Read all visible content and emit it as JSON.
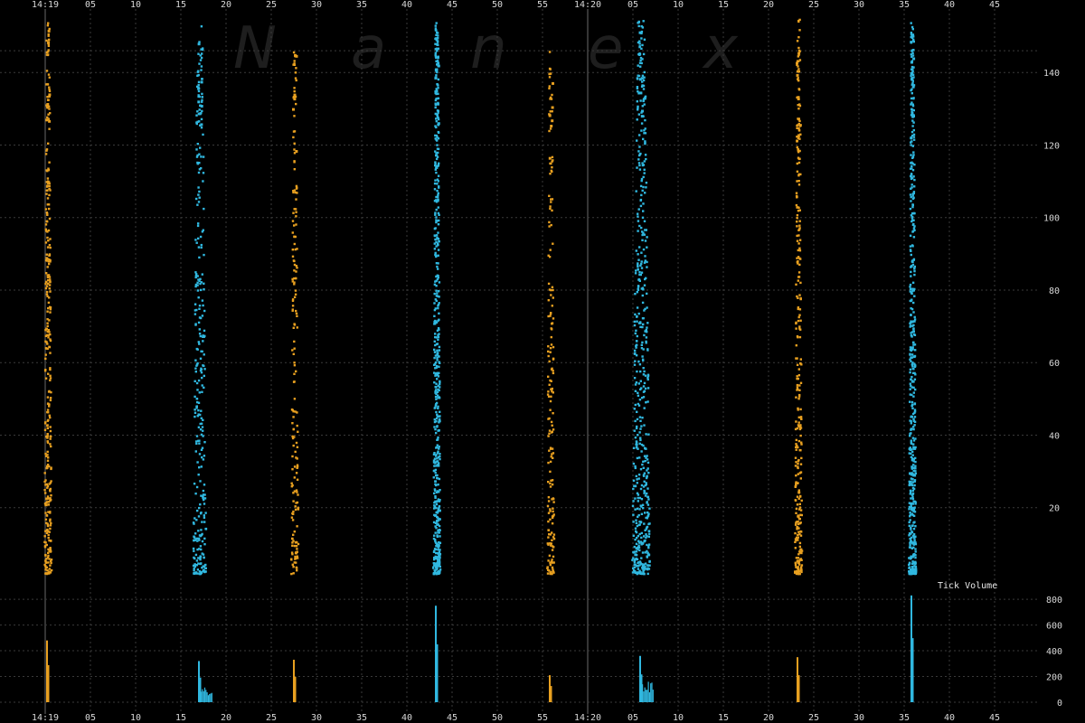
{
  "watermark": [
    "N",
    "a",
    "n",
    "e",
    "x"
  ],
  "colors": {
    "background": "#000000",
    "orange": "#e8a020",
    "blue": "#30b8e0",
    "grid": "#3a3a3a",
    "text": "#d8d8d8"
  },
  "chart_data": [
    {
      "type": "scatter",
      "title": "",
      "xlabel": "",
      "ylabel": "",
      "x_unit": "seconds after 14:19",
      "xlim": [
        -2,
        48
      ],
      "x_tick_labels": [
        "14:19",
        "05",
        "10",
        "15",
        "20",
        "25",
        "30",
        "35",
        "40",
        "45",
        "50",
        "55",
        "14:20",
        "05",
        "10",
        "15",
        "20",
        "25",
        "30",
        "35",
        "40",
        "45"
      ],
      "ylim": [
        0,
        157
      ],
      "y_ticks": [
        20,
        40,
        60,
        80,
        100,
        120,
        140
      ],
      "grid": true,
      "legend": "none",
      "series": [
        {
          "color": "orange",
          "x": 0.2,
          "y_range": [
            2,
            155
          ],
          "density": "high"
        },
        {
          "color": "blue",
          "x": 17.0,
          "y_range": [
            2,
            154
          ],
          "density": "high",
          "width": 1.5
        },
        {
          "color": "orange",
          "x": 27.5,
          "y_range": [
            2,
            146
          ],
          "density": "medium"
        },
        {
          "color": "blue",
          "x": 43.2,
          "y_range": [
            2,
            155
          ],
          "density": "very high"
        },
        {
          "color": "orange",
          "x": 55.8,
          "y_range": [
            2,
            146
          ],
          "density": "medium"
        },
        {
          "color": "blue",
          "x": 65.8,
          "y_range": [
            2,
            155
          ],
          "density": "very high",
          "width": 2
        },
        {
          "color": "orange",
          "x": 83.2,
          "y_range": [
            2,
            155
          ],
          "density": "high"
        },
        {
          "color": "blue",
          "x": 95.8,
          "y_range": [
            2,
            155
          ],
          "density": "very high"
        }
      ]
    },
    {
      "type": "bar",
      "title": "Tick Volume",
      "ylim": [
        0,
        850
      ],
      "y_ticks": [
        0,
        200,
        400,
        600,
        800
      ],
      "bars": [
        {
          "color": "orange",
          "x": 0.2,
          "peak": 480
        },
        {
          "color": "blue",
          "x": 17.0,
          "peak": 320,
          "tail": 120
        },
        {
          "color": "orange",
          "x": 27.5,
          "peak": 330
        },
        {
          "color": "blue",
          "x": 43.2,
          "peak": 750
        },
        {
          "color": "orange",
          "x": 55.8,
          "peak": 210
        },
        {
          "color": "blue",
          "x": 65.8,
          "peak": 360,
          "tail": 160
        },
        {
          "color": "orange",
          "x": 83.2,
          "peak": 350
        },
        {
          "color": "blue",
          "x": 95.8,
          "peak": 830
        }
      ]
    }
  ]
}
